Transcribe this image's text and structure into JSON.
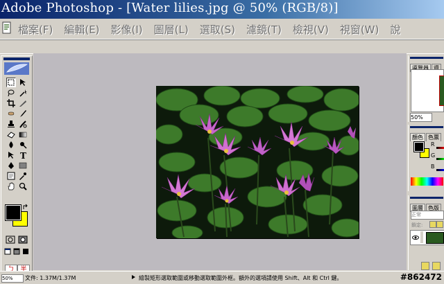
{
  "window": {
    "title": "Adobe Photoshop - [Water lilies.jpg @ 50% (RGB/8)]"
  },
  "menu": {
    "items": [
      "檔案(F)",
      "編輯(E)",
      "影像(I)",
      "圖層(L)",
      "選取(S)",
      "濾鏡(T)",
      "檢視(V)",
      "視窗(W)",
      "說"
    ]
  },
  "navigator_panel": {
    "tabs": [
      "導覽器",
      "資"
    ],
    "zoom": "50%"
  },
  "color_panel": {
    "tabs": [
      "顏色",
      "色票"
    ],
    "channels": [
      "R",
      "G",
      "B"
    ]
  },
  "layers_panel": {
    "tabs": [
      "圖層",
      "色版"
    ],
    "blend_mode": "正常",
    "lock_label": "鎖定:"
  },
  "status_bar": {
    "zoom": "50%",
    "doc_info": "文件: 1.37M/1.37M",
    "hint": "繪製矩形選取範圍或移動選取範圍外框。額外的選項請使用 Shift、Alt 和 Ctrl 鍵。"
  },
  "toolbox": {
    "type_tool_label": "T",
    "mode_labels": [
      "ㄅ",
      "半"
    ]
  },
  "watermark": "#862472",
  "colors": {
    "foreground": "#000000",
    "background": "#ffff00",
    "title_bar": "#0a246a",
    "workspace": "#bdbabf"
  }
}
